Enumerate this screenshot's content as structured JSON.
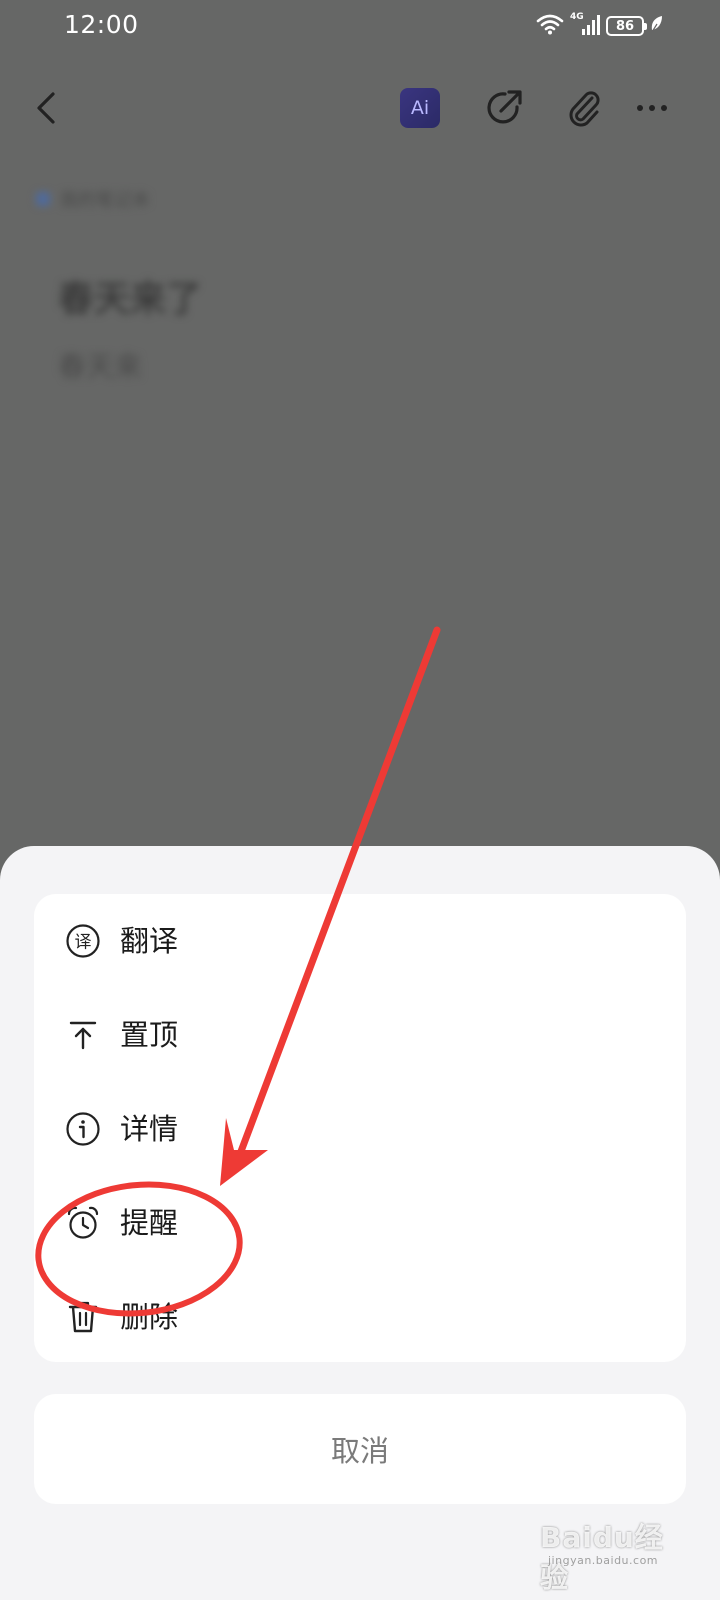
{
  "status_bar": {
    "time": "12:00",
    "network": "4G",
    "battery": "86"
  },
  "toolbar": {
    "ai_label": "Ai"
  },
  "note": {
    "folder": "我的笔记本",
    "title": "春天来了",
    "body": "春天来"
  },
  "sheet": {
    "items": [
      {
        "label": "翻译",
        "icon": "translate-icon"
      },
      {
        "label": "置顶",
        "icon": "pin-top-icon"
      },
      {
        "label": "详情",
        "icon": "info-icon"
      },
      {
        "label": "提醒",
        "icon": "alarm-clock-icon"
      },
      {
        "label": "删除",
        "icon": "trash-icon"
      }
    ],
    "cancel_label": "取消"
  },
  "annotation": {
    "color": "#ee3a35"
  },
  "watermark": {
    "text": "Baidu经验",
    "sub": "jingyan.baidu.com"
  },
  "colors": {
    "overlay": "#666766",
    "sheet_bg": "#f4f4f6",
    "card_bg": "#ffffff",
    "ai_badge": "#2f2d70"
  }
}
